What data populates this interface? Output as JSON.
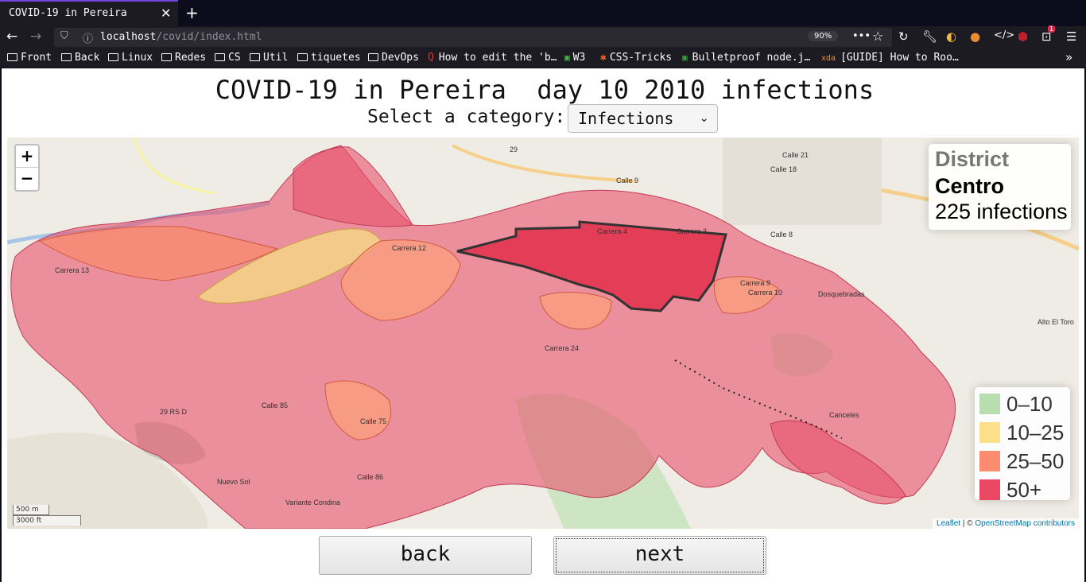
{
  "browser": {
    "tab_title": "COVID-19 in Pereira",
    "url_host": "localhost",
    "url_path": "/covid/index.html",
    "zoom": "90%",
    "notification_count": "1",
    "bookmarks": [
      {
        "label": "Front",
        "icon": "folder-icon"
      },
      {
        "label": "Back",
        "icon": "folder-icon"
      },
      {
        "label": "Linux",
        "icon": "folder-icon"
      },
      {
        "label": "Redes",
        "icon": "folder-icon"
      },
      {
        "label": "CS",
        "icon": "folder-icon"
      },
      {
        "label": "Util",
        "icon": "folder-icon"
      },
      {
        "label": "tiquetes",
        "icon": "folder-icon"
      },
      {
        "label": "DevOps",
        "icon": "folder-icon"
      },
      {
        "label": "How to edit the 'b…",
        "icon": "site-icon"
      },
      {
        "label": "W3",
        "icon": "w3-icon"
      },
      {
        "label": "CSS-Tricks",
        "icon": "css-tricks-icon"
      },
      {
        "label": "Bulletproof node.j…",
        "icon": "site-icon"
      },
      {
        "label": "[GUIDE] How to Roo…",
        "icon": "xda-icon"
      }
    ]
  },
  "page": {
    "heading": "COVID-19 in Pereira  day 10 2010 infections",
    "category_label": "Select a category:",
    "category_selected": "Infections",
    "back_label": "back",
    "next_label": "next"
  },
  "map": {
    "zoom_in": "+",
    "zoom_out": "−",
    "info": {
      "heading": "District",
      "district": "Centro",
      "value": "225 infections"
    },
    "legend": [
      {
        "label": "0–10",
        "color": "#a6d49b"
      },
      {
        "label": "10–25",
        "color": "#fbd76b"
      },
      {
        "label": "25–50",
        "color": "#fc6e4c"
      },
      {
        "label": "50+",
        "color": "#e31a3c"
      }
    ],
    "scale": {
      "metric": "500 m",
      "imperial": "3000 ft"
    },
    "attribution": {
      "leaflet": "Leaflet",
      "sep": " | © ",
      "osm": "OpenStreetMap contributors"
    },
    "labels": [
      "Calle 9",
      "Carrera 4",
      "Carrera 3",
      "Calle 8",
      "Calle 18",
      "Calle 21",
      "Carrera 9",
      "Carrera 10",
      "Carrera 12",
      "Carrera 13",
      "Carrera 24",
      "Calle 85",
      "Calle 75",
      "Calle 86",
      "29 RS D",
      "Nuevo Sol",
      "Variante Condina",
      "Canceles",
      "Alto El Toro",
      "Dosquebradas",
      "29"
    ]
  }
}
